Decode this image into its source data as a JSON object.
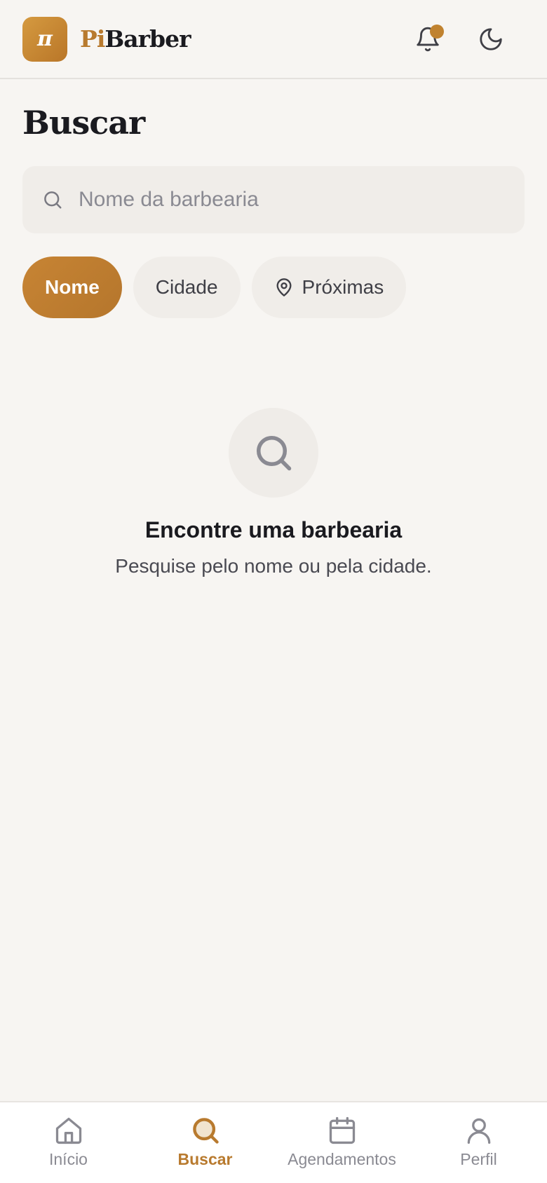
{
  "header": {
    "logo_glyph": "π",
    "brand_part1": "Pi",
    "brand_part2": "Barber",
    "notification_icon": "bell-icon",
    "theme_icon": "moon-icon",
    "accent_color": "#c0822f"
  },
  "page": {
    "title": "Buscar"
  },
  "search": {
    "placeholder": "Nome da barbearia",
    "value": ""
  },
  "filters": {
    "options": [
      {
        "label": "Nome",
        "active": true
      },
      {
        "label": "Cidade",
        "active": false
      },
      {
        "label": "Próximas",
        "active": false,
        "icon": "map-pin-icon"
      }
    ]
  },
  "empty_state": {
    "icon": "search-icon",
    "title": "Encontre uma barbearia",
    "subtitle": "Pesquise pelo nome ou pela cidade."
  },
  "bottom_nav": {
    "items": [
      {
        "label": "Início",
        "icon": "home-icon",
        "active": false
      },
      {
        "label": "Buscar",
        "icon": "search-icon",
        "active": true
      },
      {
        "label": "Agendamentos",
        "icon": "calendar-icon",
        "active": false
      },
      {
        "label": "Perfil",
        "icon": "user-icon",
        "active": false
      }
    ]
  }
}
